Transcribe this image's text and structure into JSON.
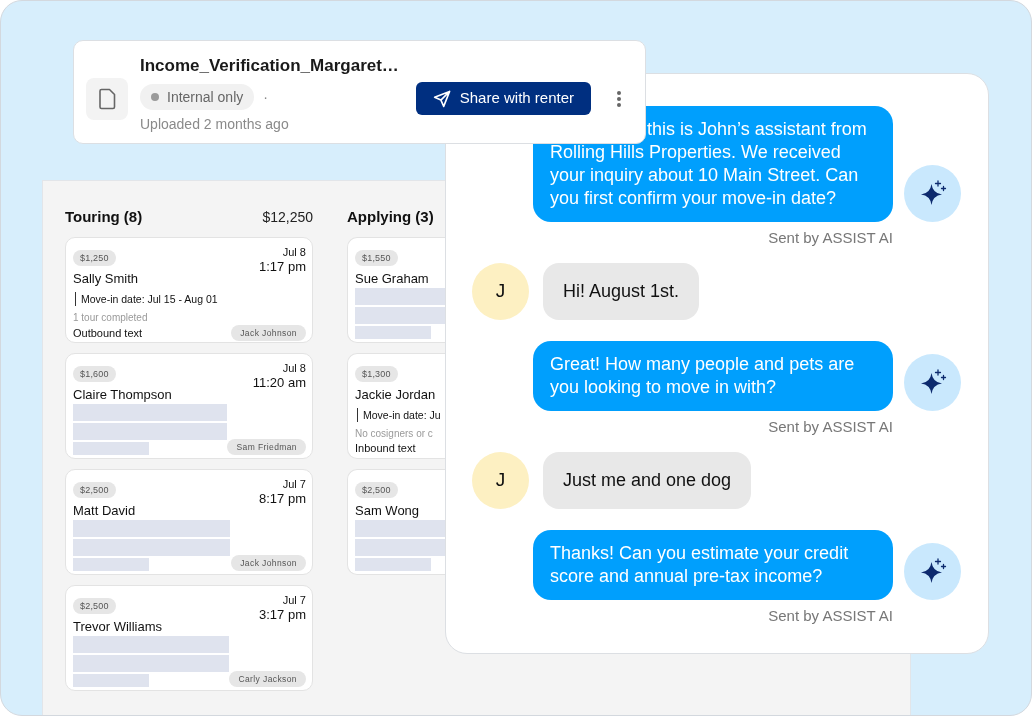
{
  "file_card": {
    "title": "Income_Verification_Margaret…",
    "visibility": "Internal only",
    "separator": "·",
    "uploaded": "Uploaded 2 months ago",
    "share_button": "Share with renter"
  },
  "board": {
    "columns": [
      {
        "title": "Touring (8)",
        "total": "$12,250",
        "cards": [
          {
            "kind": "detail",
            "price": "$1,250",
            "name": "Sally Smith",
            "date": "Jul 8",
            "time": "1:17 pm",
            "move_in": "Move-in date: Jul 15 - Aug 01",
            "note": "1 tour completed",
            "channel": "Outbound text",
            "agent": "Jack Johnson"
          },
          {
            "kind": "loading",
            "price": "$1,600",
            "name": "Claire Thompson",
            "date": "Jul 8",
            "time": "11:20 am",
            "agent": "Sam Friedman"
          },
          {
            "kind": "loading",
            "price": "$2,500",
            "name": "Matt David",
            "date": "Jul 7",
            "time": "8:17 pm",
            "agent": "Jack Johnson"
          },
          {
            "kind": "loading",
            "price": "$2,500",
            "name": "Trevor Williams",
            "date": "Jul 7",
            "time": "3:17 pm",
            "agent": "Carly Jackson"
          }
        ]
      },
      {
        "title": "Applying (3)",
        "cards": [
          {
            "kind": "loading",
            "price": "$1,550",
            "name": "Sue Graham"
          },
          {
            "kind": "detail",
            "price": "$1,300",
            "name": "Jackie Jordan",
            "move_in": "Move-in date: Ju",
            "note": "No cosigners or c",
            "channel": "Inbound text"
          },
          {
            "kind": "loading",
            "price": "$2,500",
            "name": "Sam Wong"
          }
        ]
      }
    ]
  },
  "chat": {
    "messages": [
      {
        "kind": "assistant",
        "text": "this is John’s assistant from Rolling Hills Properties. We received your inquiry about 10 Main Street. Can you first confirm your move-in date?",
        "caption": "Sent by ASSIST AI"
      },
      {
        "kind": "renter",
        "initial": "J",
        "text": "Hi! August 1st."
      },
      {
        "kind": "assistant",
        "text": "Great! How many people and pets are you looking to move in with?",
        "caption": "Sent by ASSIST AI"
      },
      {
        "kind": "renter",
        "initial": "J",
        "text": "Just me and one dog"
      },
      {
        "kind": "assistant",
        "text": "Thanks! Can you estimate your credit score and annual pre-tax income?",
        "caption": "Sent by ASSIST AI"
      }
    ]
  }
}
